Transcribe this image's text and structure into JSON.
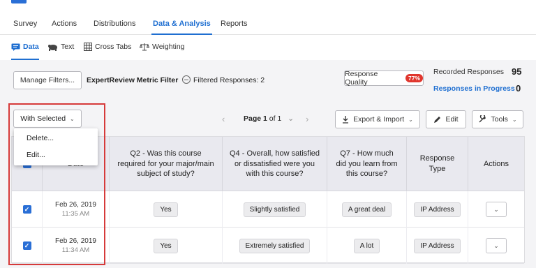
{
  "main_tabs": [
    "Survey",
    "Actions",
    "Distributions",
    "Data & Analysis",
    "Reports"
  ],
  "main_tab_active": "Data & Analysis",
  "sub_tabs": [
    {
      "label": "Data",
      "icon": "data-icon"
    },
    {
      "label": "Text",
      "icon": "text-analysis-icon"
    },
    {
      "label": "Cross Tabs",
      "icon": "grid-icon"
    },
    {
      "label": "Weighting",
      "icon": "scale-icon"
    }
  ],
  "filters": {
    "manage_label": "Manage Filters...",
    "filter_name": "ExpertReview Metric Filter",
    "filtered_text": "Filtered Responses: 2",
    "response_quality_label": "Response Quality",
    "response_quality_badge": "77%"
  },
  "stats": {
    "recorded_label": "Recorded Responses",
    "recorded_value": "95",
    "in_progress_label": "Responses in Progress",
    "in_progress_value": "0"
  },
  "toolbar": {
    "with_selected": "With Selected",
    "page_bold": "Page 1",
    "page_rest": " of 1",
    "export_label": "Export & Import",
    "edit_label": "Edit",
    "tools_label": "Tools"
  },
  "menu": [
    "Delete...",
    "Edit..."
  ],
  "table": {
    "headers": {
      "date": "Date",
      "q2": "Q2 - Was this course required for your major/main subject of study?",
      "q4": "Q4 - Overall, how satisfied or dissatisfied were you with this course?",
      "q7": "Q7 - How much did you learn from this course?",
      "type": "Response Type",
      "actions": "Actions"
    },
    "rows": [
      {
        "date": "Feb 26, 2019",
        "time": "11:35 AM",
        "q2": "Yes",
        "q4": "Slightly satisfied",
        "q7": "A great deal",
        "type": "IP Address"
      },
      {
        "date": "Feb 26, 2019",
        "time": "11:34 AM",
        "q2": "Yes",
        "q4": "Extremely satisfied",
        "q7": "A lot",
        "type": "IP Address"
      }
    ]
  },
  "colors": {
    "accent": "#1f6fd1",
    "badge": "#e0362d",
    "highlight": "#d63a3a"
  }
}
